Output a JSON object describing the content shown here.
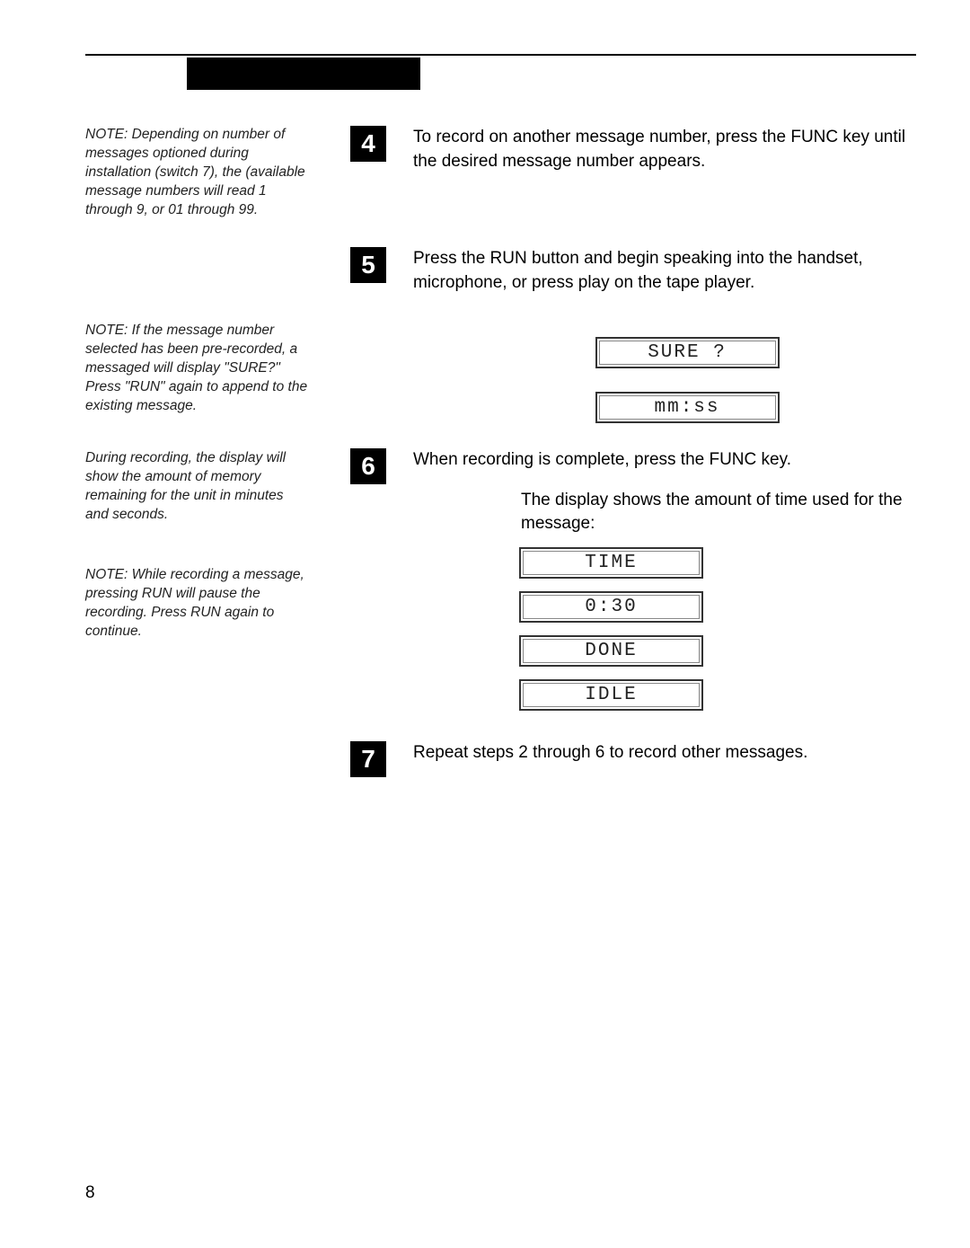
{
  "notes": {
    "n1": "NOTE: Depending on number of messages optioned during installation (switch 7), the (available message numbers will read 1 through 9, or 01 through 99.",
    "n2": "NOTE: If the message number selected has been pre-recorded, a messaged will display \"SURE?\" Press \"RUN\" again to append to the existing message.",
    "n3": "During recording, the display will show the amount of memory remaining for the unit in minutes and seconds.",
    "n4": "NOTE: While recording a message, pressing RUN will pause the recording. Press RUN again to continue."
  },
  "steps": {
    "s4": {
      "num": "4",
      "text": "To record on another message number, press the FUNC key until the desired message number appears."
    },
    "s5": {
      "num": "5",
      "text": "Press the RUN button and begin speaking into the handset, microphone, or press play on the tape player."
    },
    "s6": {
      "num": "6",
      "text": "When recording is complete, press the FUNC key.",
      "caption": "The display shows the amount of time used for the message:"
    },
    "s7": {
      "num": "7",
      "text": "Repeat steps 2 through 6 to record other messages."
    }
  },
  "displays": {
    "sure": "SURE ?",
    "mmss": "mm:ss",
    "time": "TIME",
    "t030": "0:30",
    "done": "DONE",
    "idle": "IDLE"
  },
  "page_number": "8"
}
